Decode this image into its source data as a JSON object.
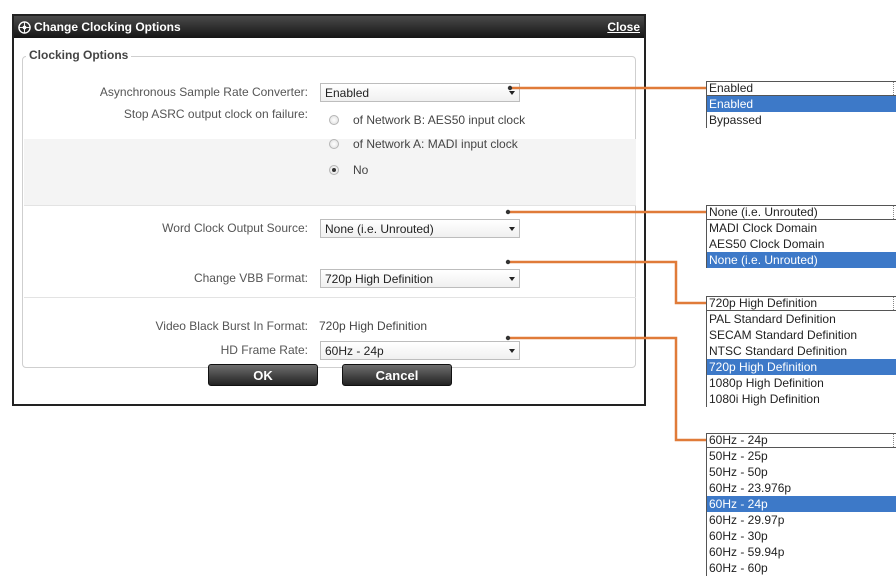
{
  "dialog": {
    "title": "Change Clocking Options",
    "close_label": "Close",
    "section_title": "Clocking Options",
    "asrc_label": "Asynchronous Sample Rate Converter:",
    "asrc_value": "Enabled",
    "stop_label": "Stop ASRC output clock on failure:",
    "radio_options": [
      "of Network B: AES50 input clock",
      "of Network A: MADI input clock",
      "No"
    ],
    "wordclock_label": "Word Clock Output Source:",
    "wordclock_value": "None (i.e. Unrouted)",
    "vbb_label": "Change VBB Format:",
    "vbb_value": "720p High Definition",
    "vbb_in_label": "Video Black Burst In Format:",
    "vbb_in_value": "720p High Definition",
    "framerate_label": "HD Frame Rate:",
    "framerate_value": "60Hz - 24p",
    "ok_label": "OK",
    "cancel_label": "Cancel"
  },
  "popups": {
    "asrc": {
      "current": "Enabled",
      "options": [
        "Enabled",
        "Bypassed"
      ],
      "selected": 0
    },
    "wordclock": {
      "current": "None (i.e. Unrouted)",
      "options": [
        "MADI Clock Domain",
        "AES50 Clock Domain",
        "None (i.e. Unrouted)"
      ],
      "selected": 2
    },
    "vbb": {
      "current": "720p High Definition",
      "options": [
        "PAL Standard Definition",
        "SECAM Standard Definition",
        "NTSC Standard Definition",
        "720p High Definition",
        "1080p High Definition",
        "1080i High Definition"
      ],
      "selected": 3
    },
    "framerate": {
      "current": "60Hz - 24p",
      "options": [
        "50Hz - 25p",
        "50Hz - 50p",
        "60Hz - 23.976p",
        "60Hz - 24p",
        "60Hz - 29.97p",
        "60Hz - 30p",
        "60Hz - 59.94p",
        "60Hz - 60p"
      ],
      "selected": 3
    }
  },
  "colors": {
    "connector": "#e07b39",
    "selection": "#3d79c8"
  }
}
